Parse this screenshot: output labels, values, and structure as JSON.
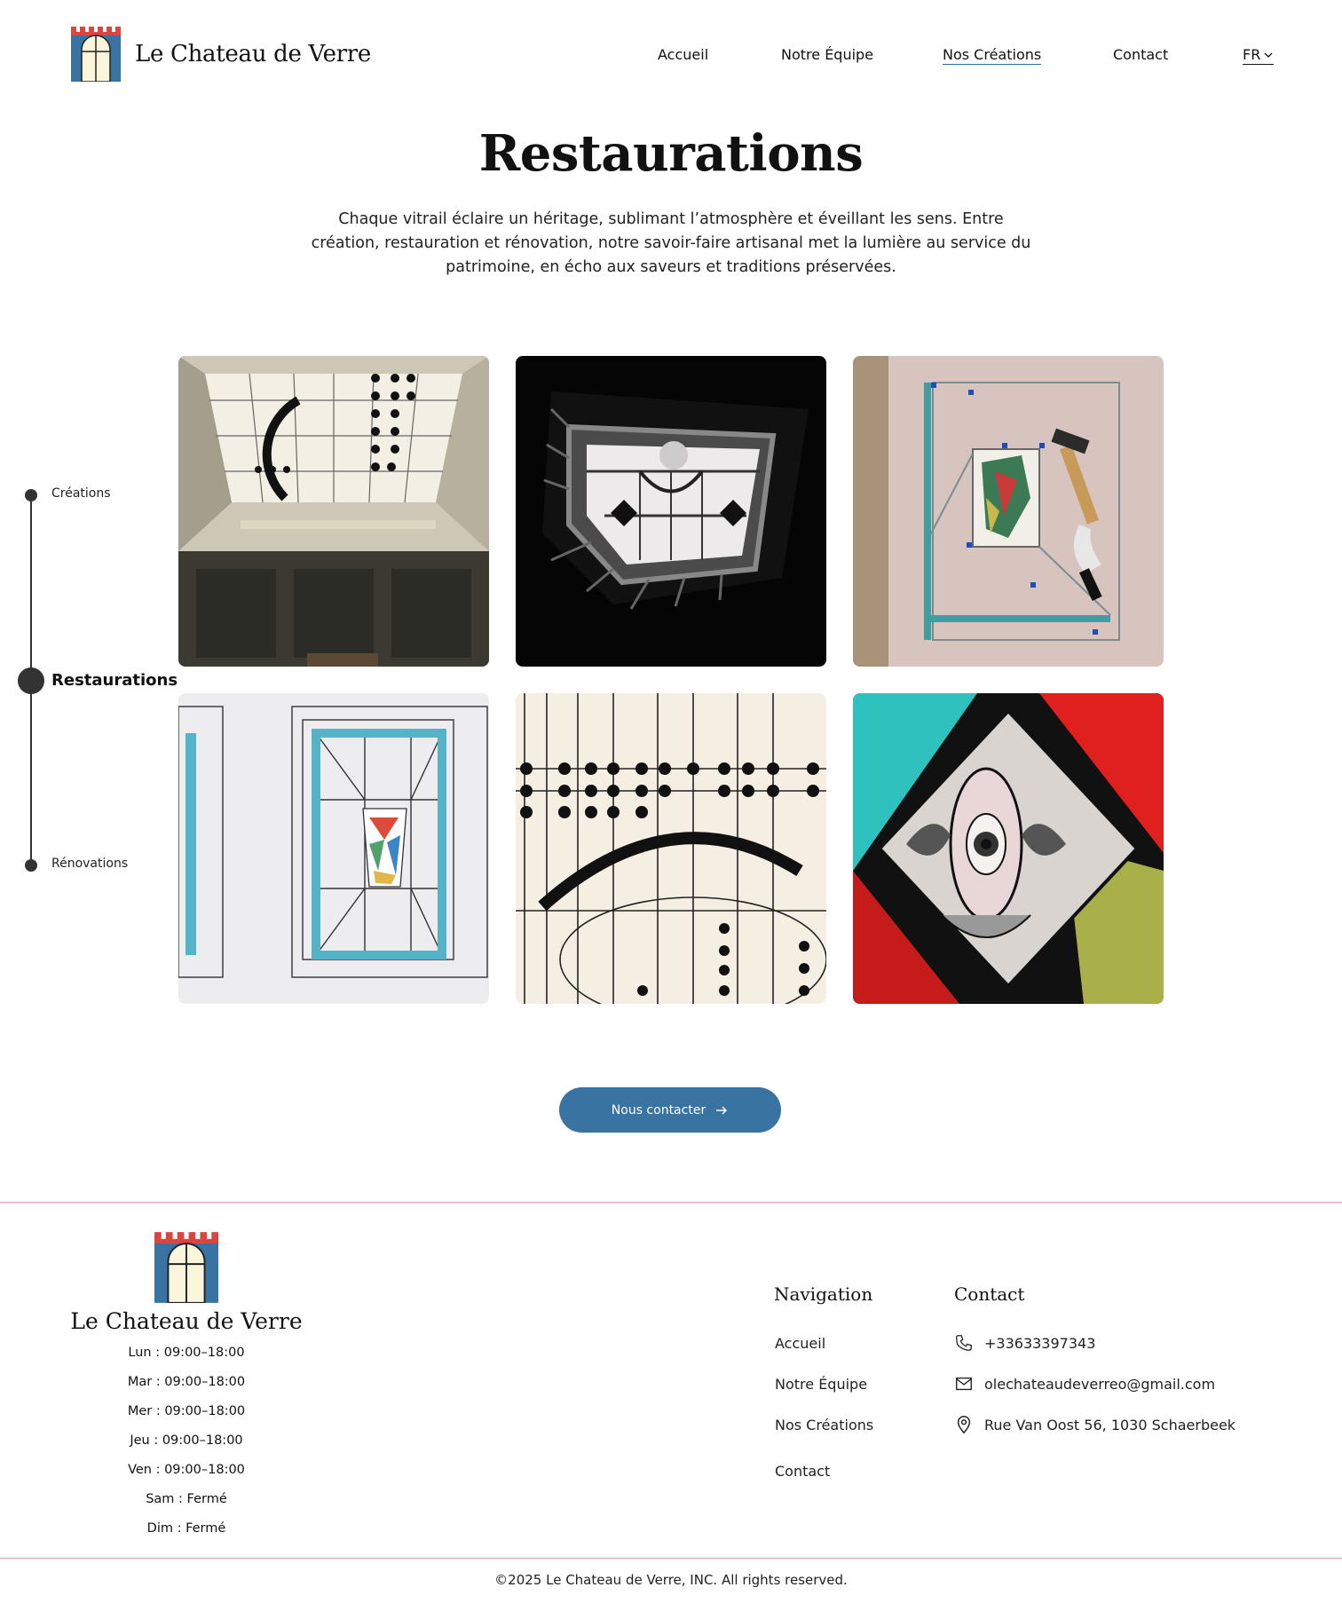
{
  "brand": {
    "name": "Le Chateau de Verre"
  },
  "nav": {
    "items": [
      {
        "label": "Accueil"
      },
      {
        "label": "Notre Équipe"
      },
      {
        "label": "Nos Créations"
      },
      {
        "label": "Contact"
      }
    ],
    "active_index": 2,
    "language": "FR"
  },
  "page": {
    "title": "Restaurations",
    "intro": "Chaque vitrail éclaire un héritage, sublimant l’atmosphère et éveillant les sens. Entre création, restauration et rénovation, notre savoir-faire artisanal met la lumière au service du patrimoine, en écho aux saveurs et traditions préservées."
  },
  "timeline": {
    "items": [
      {
        "label": "Créations"
      },
      {
        "label": "Restaurations"
      },
      {
        "label": "Rénovations"
      }
    ],
    "active_index": 1
  },
  "gallery": {
    "images": [
      {
        "subject": "stained-glass-ceiling"
      },
      {
        "subject": "stairwell-skylight"
      },
      {
        "subject": "workbench-restoration"
      },
      {
        "subject": "stained-glass-sketch"
      },
      {
        "subject": "geometric-glass-detail"
      },
      {
        "subject": "painted-glass-eye"
      }
    ]
  },
  "cta": {
    "label": "Nous contacter"
  },
  "footer": {
    "brand_name": "Le Chateau de Verre",
    "hours": [
      "Lun : 09:00–18:00",
      "Mar : 09:00–18:00",
      "Mer : 09:00–18:00",
      "Jeu : 09:00–18:00",
      "Ven : 09:00–18:00",
      "Sam : Fermé",
      "Dim : Fermé"
    ],
    "navigation": {
      "title": "Navigation",
      "links": [
        "Accueil",
        "Notre Équipe",
        "Nos Créations",
        "Contact"
      ]
    },
    "contact": {
      "title": "Contact",
      "phone": "+33633397343",
      "email": "olechateaudeverreo@gmail.com",
      "address": "Rue Van Oost 56, 1030 Schaerbeek"
    },
    "copyright": "©2025 Le Chateau de Verre, INC. All rights reserved."
  },
  "colors": {
    "accent_blue": "#3873a1",
    "footer_line": "#e3a0a3",
    "logo_red": "#d9453f",
    "logo_cream": "#fbf5dc"
  }
}
